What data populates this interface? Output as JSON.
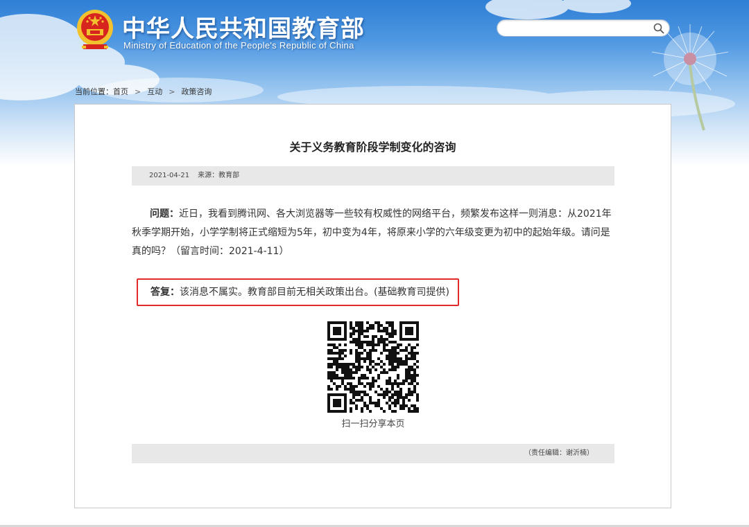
{
  "header": {
    "title": "中华人民共和国教育部",
    "subtitle": "Ministry of Education of the People's Republic of China"
  },
  "search": {
    "placeholder": "",
    "value": "",
    "icon": "search-icon"
  },
  "breadcrumb": {
    "label": "当前位置：",
    "items": [
      "首页",
      "互动",
      "政策咨询"
    ],
    "separator": ">"
  },
  "article": {
    "title": "关于义务教育阶段学制变化的咨询",
    "date": "2021-04-21",
    "source_label": "来源：",
    "source": "教育部",
    "question_label": "问题：",
    "question_text": "近日，我看到腾讯网、各大浏览器等一些较有权威性的网络平台，频繁发布这样一则消息：从2021年秋季学期开始，小学学制将正式缩短为5年，初中变为4年，将原来小学的六年级变更为初中的起始年级。请问是真的吗？（留言时间：2021-4-11）",
    "answer_label": "答复：",
    "answer_text": "该消息不属实。教育部目前无相关政策出台。(基础教育司提供)",
    "qr_caption": "扫一扫分享本页",
    "editor": "（责任编辑：谢沂楠）"
  },
  "colors": {
    "header_blue": "#2f7fd6",
    "highlight_red": "#e02a2a",
    "bar_gray": "#e8e8e8"
  }
}
